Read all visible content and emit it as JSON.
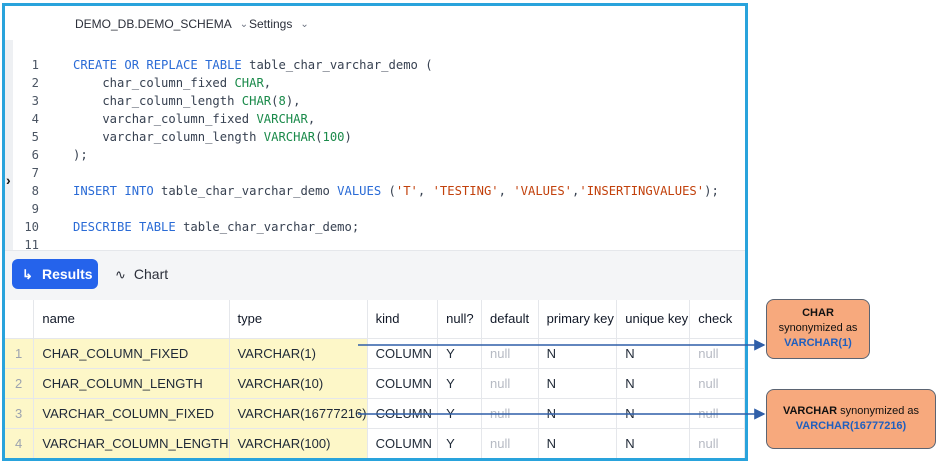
{
  "breadcrumb": {
    "db_schema": "DEMO_DB.DEMO_SCHEMA",
    "settings": "Settings"
  },
  "editor": {
    "lines": [
      {
        "n": "1",
        "parts": [
          [
            "kw",
            "CREATE OR REPLACE TABLE"
          ],
          [
            "pn",
            " table_char_varchar_demo ("
          ]
        ]
      },
      {
        "n": "2",
        "parts": [
          [
            "pn",
            "    char_column_fixed "
          ],
          [
            "ty",
            "CHAR"
          ],
          [
            "pn",
            ","
          ]
        ]
      },
      {
        "n": "3",
        "parts": [
          [
            "pn",
            "    char_column_length "
          ],
          [
            "ty",
            "CHAR"
          ],
          [
            "pn",
            "("
          ],
          [
            "ty",
            "8"
          ],
          [
            "pn",
            "),"
          ]
        ]
      },
      {
        "n": "4",
        "parts": [
          [
            "pn",
            "    varchar_column_fixed "
          ],
          [
            "ty",
            "VARCHAR"
          ],
          [
            "pn",
            ","
          ]
        ]
      },
      {
        "n": "5",
        "parts": [
          [
            "pn",
            "    varchar_column_length "
          ],
          [
            "ty",
            "VARCHAR"
          ],
          [
            "pn",
            "("
          ],
          [
            "ty",
            "100"
          ],
          [
            "pn",
            ")"
          ]
        ]
      },
      {
        "n": "6",
        "parts": [
          [
            "pn",
            ");"
          ]
        ]
      },
      {
        "n": "7",
        "parts": []
      },
      {
        "n": "8",
        "parts": [
          [
            "kw",
            "INSERT INTO"
          ],
          [
            "pn",
            " table_char_varchar_demo "
          ],
          [
            "kw",
            "VALUES"
          ],
          [
            "pn",
            " ("
          ],
          [
            "str",
            "'T'"
          ],
          [
            "pn",
            ", "
          ],
          [
            "str",
            "'TESTING'"
          ],
          [
            "pn",
            ", "
          ],
          [
            "str",
            "'VALUES'"
          ],
          [
            "pn",
            ","
          ],
          [
            "str",
            "'INSERTINGVALUES'"
          ],
          [
            "pn",
            ");"
          ]
        ]
      },
      {
        "n": "9",
        "parts": []
      },
      {
        "n": "10",
        "parts": [
          [
            "kw",
            "DESCRIBE TABLE"
          ],
          [
            "pn",
            " table_char_varchar_demo;"
          ]
        ]
      },
      {
        "n": "11",
        "parts": []
      }
    ]
  },
  "toolbar": {
    "results_label": "Results",
    "chart_label": "Chart"
  },
  "table": {
    "columns": [
      "name",
      "type",
      "kind",
      "null?",
      "default",
      "primary key",
      "unique key",
      "check"
    ],
    "rows": [
      {
        "num": "1",
        "name": "CHAR_COLUMN_FIXED",
        "type": "VARCHAR(1)",
        "kind": "COLUMN",
        "null": "Y",
        "default": "null",
        "pk": "N",
        "uk": "N",
        "check": "null"
      },
      {
        "num": "2",
        "name": "CHAR_COLUMN_LENGTH",
        "type": "VARCHAR(10)",
        "kind": "COLUMN",
        "null": "Y",
        "default": "null",
        "pk": "N",
        "uk": "N",
        "check": "null"
      },
      {
        "num": "3",
        "name": "VARCHAR_COLUMN_FIXED",
        "type": "VARCHAR(16777216)",
        "kind": "COLUMN",
        "null": "Y",
        "default": "null",
        "pk": "N",
        "uk": "N",
        "check": "null"
      },
      {
        "num": "4",
        "name": "VARCHAR_COLUMN_LENGTH",
        "type": "VARCHAR(100)",
        "kind": "COLUMN",
        "null": "Y",
        "default": "null",
        "pk": "N",
        "uk": "N",
        "check": "null"
      }
    ]
  },
  "callouts": {
    "char": {
      "title": "CHAR",
      "text": "synonymized as",
      "value": "VARCHAR(1)"
    },
    "varchar": {
      "title": "VARCHAR",
      "text": " synonymized as",
      "value": "VARCHAR(16777216)"
    }
  },
  "colors": {
    "frame": "#29a3dc",
    "accent": "#2563eb",
    "callout": "#f7a97d",
    "arrow": "#2f5ea8",
    "highlight": "#fdf7c8"
  }
}
